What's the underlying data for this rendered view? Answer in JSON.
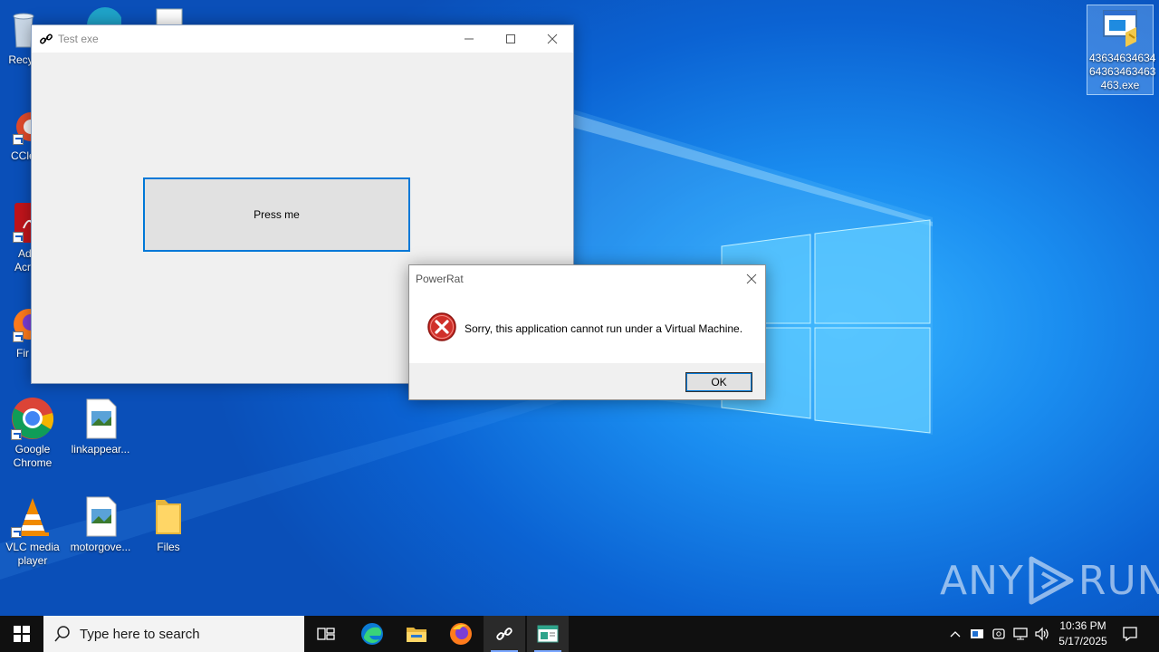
{
  "desktop": {
    "icons": [
      {
        "label": "Recycle Bin",
        "visible_label": "Recyc"
      },
      {
        "label": "CCleaner",
        "visible_label": "CCle"
      },
      {
        "label": "Adobe Acrobat",
        "visible_label_1": "Ad",
        "visible_label_2": "Acr"
      },
      {
        "label": "Firefox",
        "visible_label": "Fir"
      },
      {
        "label": "Google Chrome"
      },
      {
        "label": "linkappear..."
      },
      {
        "label": "VLC media player"
      },
      {
        "label": "motorgove..."
      },
      {
        "label": "Files"
      }
    ],
    "selected_file": {
      "label_line1": "43634634634",
      "label_line2": "64363463463",
      "label_line3": "463.exe"
    }
  },
  "test_window": {
    "title": "Test exe",
    "button_label": "Press me"
  },
  "dialog": {
    "title": "PowerRat",
    "message": "Sorry, this application cannot run under a Virtual Machine.",
    "ok_label": "OK",
    "icon": "error-icon"
  },
  "watermark": {
    "left": "ANY",
    "right": "RUN"
  },
  "taskbar": {
    "search_placeholder": "Type here to search",
    "apps": [
      "task-view-icon",
      "edge-icon",
      "file-explorer-icon",
      "firefox-icon",
      "test-exe-icon",
      "powerrat-icon"
    ],
    "time": "10:36 PM",
    "date": "5/17/2025"
  },
  "colors": {
    "accent": "#0078d7",
    "error": "#c42b1c",
    "taskbar": "#101010"
  }
}
